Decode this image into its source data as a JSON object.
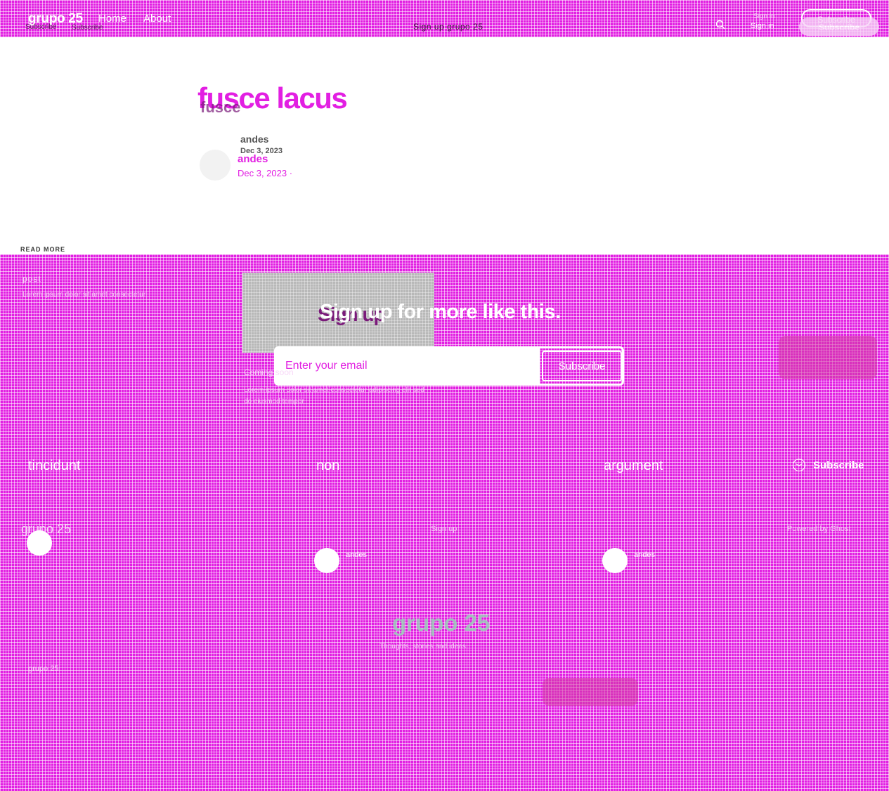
{
  "site": {
    "brand": "grupo 25",
    "brand_ghost": "Subscribe",
    "center_ghost": "Sign up grupo 25",
    "copyright": "grupo 25"
  },
  "nav": {
    "items": [
      {
        "label": "Home",
        "ghost": "Subscribe"
      },
      {
        "label": "About",
        "ghost": ""
      }
    ],
    "signin_top": "Sign in",
    "signin": "Sign in",
    "subscribe_top": "Subscribe",
    "subscribe": "Subscribe"
  },
  "post": {
    "title": "fusce lacus",
    "title_ghost": "fusce",
    "author_ghost": "andes",
    "date_ghost": "Dec 3, 2023",
    "author": "andes",
    "date": "Dec 3, 2023 ·"
  },
  "read_more": "READ MORE",
  "lower": {
    "ghost1": "post",
    "ghost2": "Lorem ipsum dolor sit amet consectetur",
    "signup_ghost": "Sign up",
    "signup": "Sign up for more like this.",
    "email_placeholder": "Enter your email",
    "form_submit": "Subscribe",
    "upcoming_ghost": "Coming soon",
    "upcoming_text": "Lorem ipsum dolor sit amet consectetur adipiscing elit sed do eiusmod tempor"
  },
  "tags": [
    "tincidunt",
    "non",
    "argument"
  ],
  "subscribe_link": "Subscribe",
  "footer": {
    "brand_ghost": "grupo 25",
    "mid": "Sign up",
    "right": "Powered by Ghost",
    "dot_labels": [
      "andes",
      "andes"
    ],
    "big_brand": "grupo 25",
    "big_brand_sub": "Thoughts, stories and ideas"
  },
  "colors": {
    "accent": "#e21fe2",
    "white": "#ffffff"
  }
}
